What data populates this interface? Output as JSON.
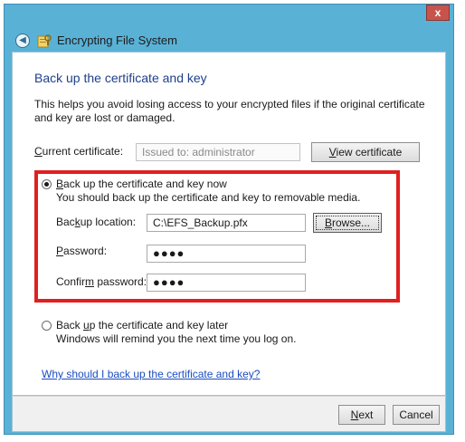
{
  "window": {
    "title": "Encrypting File System",
    "close_label": "x"
  },
  "page": {
    "heading": "Back up the certificate and key",
    "description": "This helps you avoid losing access to your encrypted files if the original certificate and key are lost or damaged."
  },
  "current_certificate": {
    "label_pre": "",
    "label_key": "C",
    "label_post": "urrent certificate:",
    "value": "Issued to: administrator",
    "view_btn_pre": "",
    "view_btn_key": "V",
    "view_btn_post": "iew certificate"
  },
  "backup_now": {
    "option_pre": "",
    "option_key": "B",
    "option_post": "ack up the certificate and key now",
    "hint": "You should back up the certificate and key to removable media.",
    "location_label_pre": "Bac",
    "location_label_key": "k",
    "location_label_post": "up location:",
    "location_value": "C:\\EFS_Backup.pfx",
    "browse_pre": "",
    "browse_key": "B",
    "browse_post": "rowse...",
    "password_label_pre": "",
    "password_label_key": "P",
    "password_label_post": "assword:",
    "password_value": "●●●●",
    "confirm_label_pre": "Confir",
    "confirm_label_key": "m",
    "confirm_label_post": " password:",
    "confirm_value": "●●●●"
  },
  "backup_later": {
    "option_pre": "Back ",
    "option_key": "u",
    "option_post": "p the certificate and key later",
    "hint": "Windows will remind you the next time you log on."
  },
  "help_link": "Why should I back up the certificate and key?",
  "footer": {
    "next_pre": "",
    "next_key": "N",
    "next_post": "ext",
    "cancel": "Cancel"
  },
  "colors": {
    "frame": "#5ab1d6",
    "heading": "#1e3f8c",
    "highlight": "#e02020",
    "link": "#1a4cc2"
  }
}
